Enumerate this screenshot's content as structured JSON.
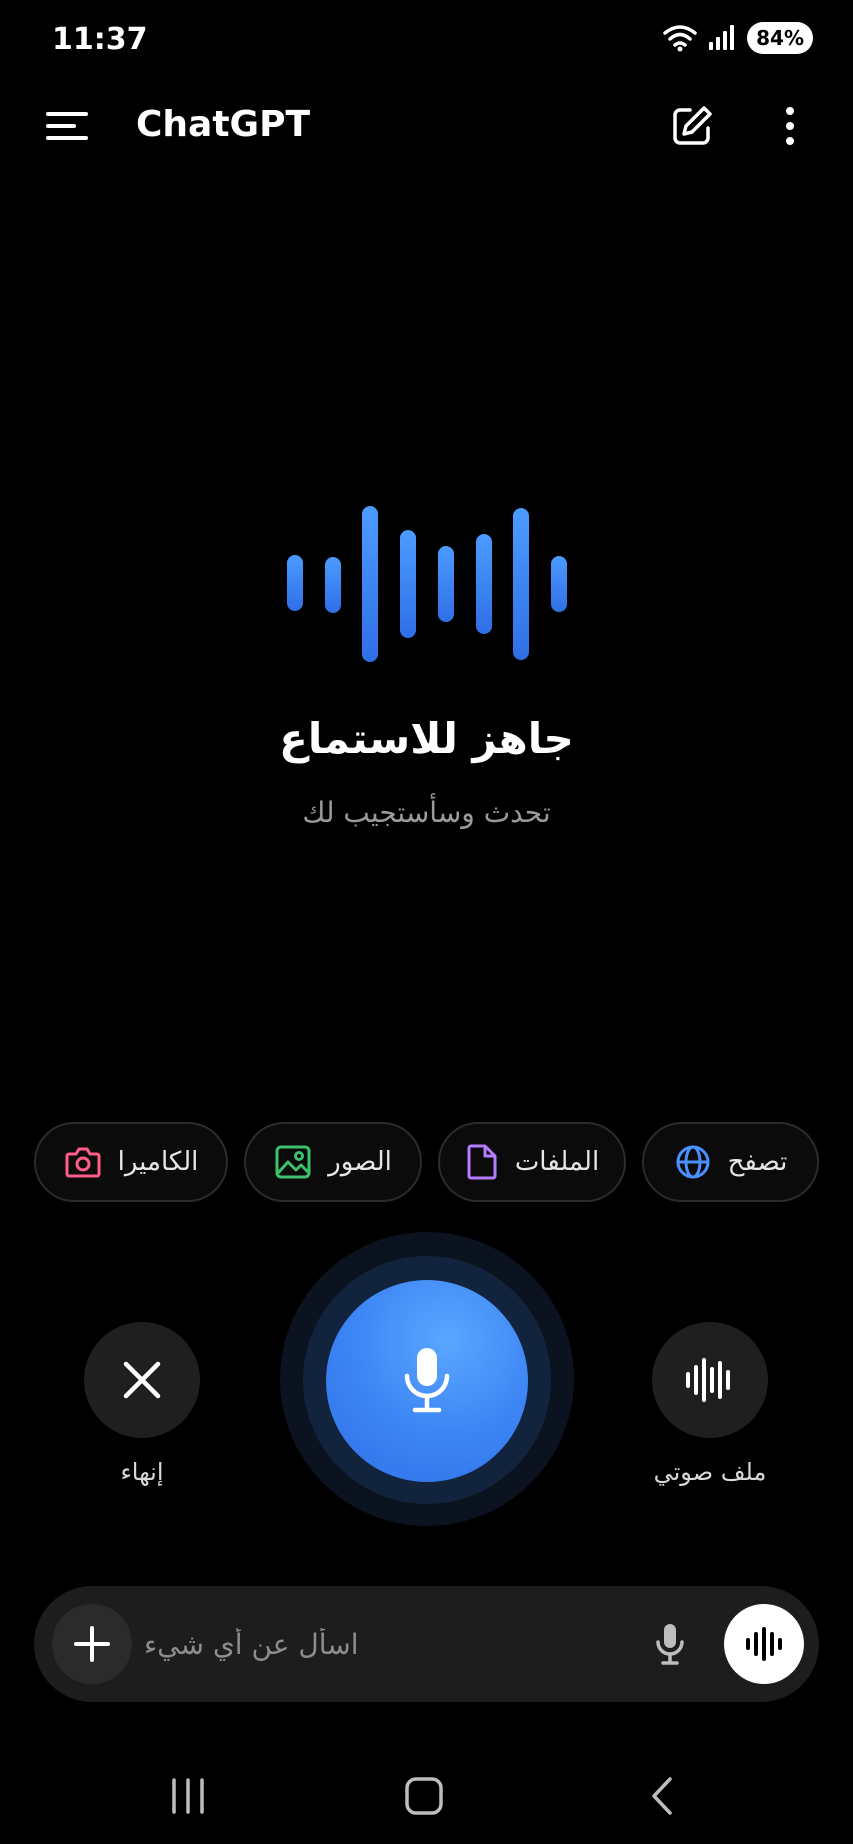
{
  "status_bar": {
    "time": "11:37",
    "battery": "84%"
  },
  "header": {
    "title": "ChatGPT"
  },
  "listening": {
    "title": "جاهز للاستماع",
    "subtitle": "تحدث وسأستجيب لك"
  },
  "chips": [
    {
      "label": "تصفح",
      "icon": "globe-icon",
      "color": "#4a90ff"
    },
    {
      "label": "الملفات",
      "icon": "file-icon",
      "color": "#b57cff"
    },
    {
      "label": "الصور",
      "icon": "image-icon",
      "color": "#3ec06d"
    },
    {
      "label": "الكاميرا",
      "icon": "camera-icon",
      "color": "#ff5c8a"
    }
  ],
  "controls": {
    "end_label": "إنهاء",
    "audio_file_label": "ملف صوتي"
  },
  "composer": {
    "placeholder": "اسأل عن أي شيء"
  },
  "colors": {
    "accent": "#3d86f5",
    "background": "#000000"
  }
}
